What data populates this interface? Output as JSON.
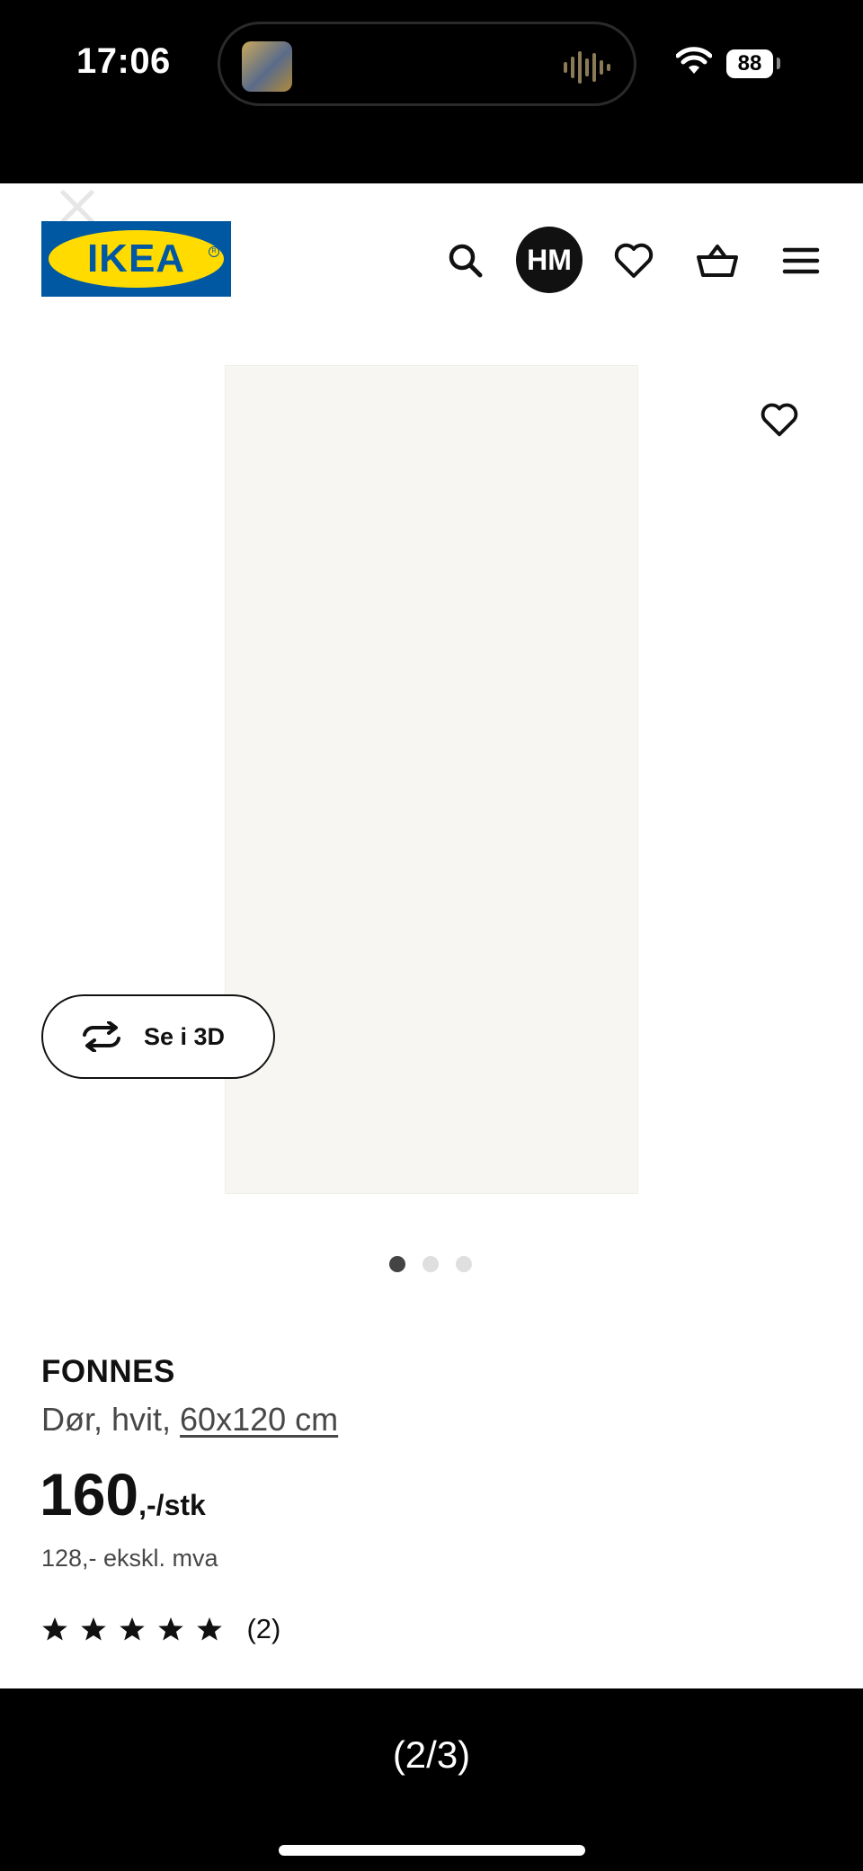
{
  "status_bar": {
    "time": "17:06",
    "battery": "88"
  },
  "brand": {
    "logo_text": "IKEA",
    "logo_blue": "#0058a3",
    "logo_yellow": "#ffdb00"
  },
  "header": {
    "avatar_initials": "HM"
  },
  "product": {
    "button_3d_label": "Se i 3D",
    "name": "FONNES",
    "description": "Dør, hvit, ",
    "size": "60x120 cm",
    "price_main": "160",
    "price_suffix": ",-/stk",
    "price_ex_vat": "128,- ekskl. mva",
    "rating_stars": 5,
    "rating_max": 5,
    "review_count": "(2)"
  },
  "carousel": {
    "total_dots": 3,
    "active_dot": 1
  },
  "footer": {
    "pager": "(2/3)"
  },
  "icons": [
    "close-icon",
    "search-icon",
    "heart-icon",
    "basket-icon",
    "menu-icon",
    "rotate-3d-icon",
    "star-icon",
    "wifi-icon",
    "waveform-icon"
  ]
}
